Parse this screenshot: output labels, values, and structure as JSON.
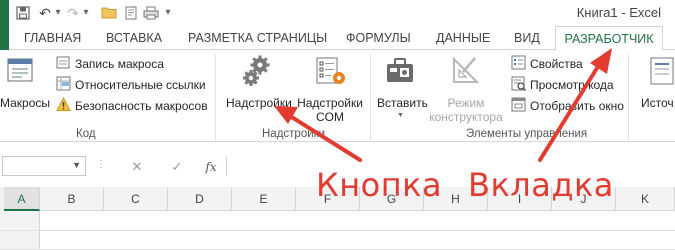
{
  "window": {
    "title": "Книга1 - Excel"
  },
  "qat": {
    "save_icon": "save-icon",
    "undo_icon": "undo-icon",
    "redo_icon": "redo-icon"
  },
  "tabs": [
    {
      "label": "ГЛАВНАЯ",
      "active": false
    },
    {
      "label": "ВСТАВКА",
      "active": false
    },
    {
      "label": "РАЗМЕТКА СТРАНИЦЫ",
      "active": false
    },
    {
      "label": "ФОРМУЛЫ",
      "active": false
    },
    {
      "label": "ДАННЫЕ",
      "active": false
    },
    {
      "label": "ВИД",
      "active": false
    },
    {
      "label": "РАЗРАБОТЧИК",
      "active": true
    }
  ],
  "ribbon": {
    "code": {
      "macros_label": "Макросы",
      "record_macro_label": "Запись макроса",
      "relative_refs_label": "Относительные ссылки",
      "macro_security_label": "Безопасность макросов",
      "group_label": "Код"
    },
    "addins": {
      "addins_label": "Надстройки",
      "com_addins_line1": "Надстройки",
      "com_addins_line2": "COM",
      "group_label": "Надстройки"
    },
    "controls": {
      "insert_label": "Вставить",
      "design_mode_line1": "Режим",
      "design_mode_line2": "конструктора",
      "properties_label": "Свойства",
      "view_code_label": "Просмотр кода",
      "run_dialog_label": "Отобразить окно",
      "group_label": "Элементы управления"
    },
    "source": {
      "source_label": "Источ"
    }
  },
  "formula_bar": {
    "name_box_value": "",
    "cancel_symbol": "✕",
    "enter_symbol": "✓",
    "fx_label": "fx",
    "formula_value": ""
  },
  "columns": [
    "A",
    "B",
    "C",
    "D",
    "E",
    "F",
    "G",
    "H",
    "I",
    "J",
    "K"
  ],
  "annotations": {
    "button_label": "Кнопка",
    "tab_label": "Вкладка"
  },
  "colors": {
    "excel_green": "#217346",
    "annotation_red": "#e23b2f"
  }
}
